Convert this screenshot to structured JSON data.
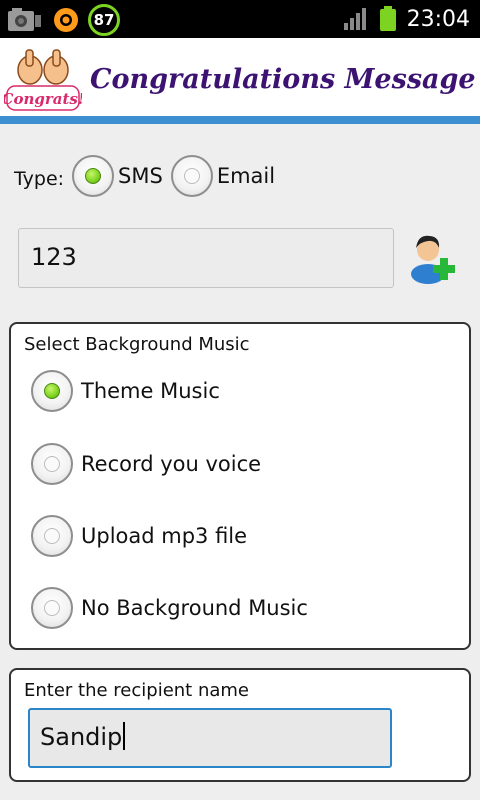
{
  "status_bar": {
    "clock": "23:04",
    "badge_value": "87",
    "icons": [
      "camera-icon",
      "circular-app-icon",
      "progress-badge-icon",
      "signal-icon",
      "battery-icon"
    ]
  },
  "title_bar": {
    "logo_text": "Congrats!",
    "title": "Congratulations Message"
  },
  "type_selector": {
    "label": "Type:",
    "options": [
      {
        "label": "SMS",
        "selected": true
      },
      {
        "label": "Email",
        "selected": false
      }
    ]
  },
  "phone_field": {
    "value": "123",
    "contact_icon": "add-contact-icon"
  },
  "music_panel": {
    "title": "Select Background Music",
    "options": [
      {
        "label": "Theme Music",
        "selected": true
      },
      {
        "label": "Record you voice",
        "selected": false
      },
      {
        "label": "Upload mp3 file",
        "selected": false
      },
      {
        "label": "No Background Music",
        "selected": false
      }
    ]
  },
  "recipient_panel": {
    "title": "Enter the recipient name",
    "value": "Sandip"
  },
  "colors": {
    "accent_line": "#3d8fd1",
    "title_text": "#3c1372",
    "radio_selected": "#7dd321",
    "focus_border": "#2a86c9"
  }
}
